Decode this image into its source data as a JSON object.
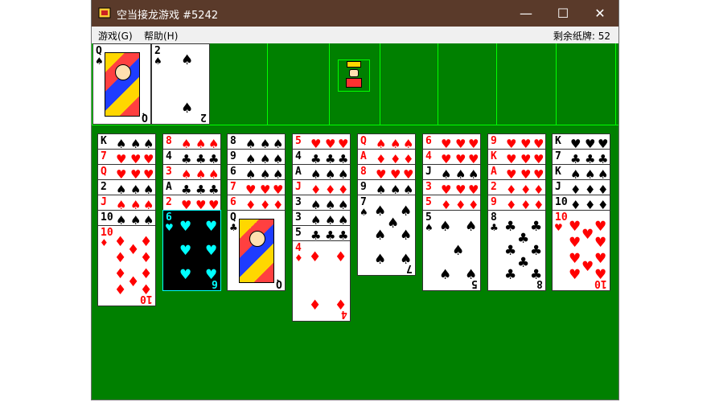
{
  "window": {
    "title": "空当接龙游戏 #5242",
    "minimize_glyph": "—",
    "maximize_glyph": "☐",
    "close_glyph": "✕"
  },
  "menu": {
    "game": "游戏(G)",
    "help": "帮助(H)",
    "status": "剩余纸牌: 52"
  },
  "free_cells": [
    {
      "rank": "Q",
      "suit": "♠",
      "color": "black",
      "face": true
    },
    {
      "rank": "2",
      "suit": "♠",
      "color": "black",
      "face": false
    },
    null,
    null
  ],
  "home_cells": [
    null,
    null,
    null,
    null
  ],
  "center_icon": "king-icon",
  "columns": [
    {
      "cards": [
        {
          "rank": "K",
          "suit": "♠",
          "color": "black"
        },
        {
          "rank": "7",
          "suit": "♥",
          "color": "red"
        },
        {
          "rank": "Q",
          "suit": "♥",
          "color": "red"
        },
        {
          "rank": "2",
          "suit": "♠",
          "color": "black"
        },
        {
          "rank": "J",
          "suit": "♠",
          "color": "red"
        },
        {
          "rank": "10",
          "suit": "♠",
          "color": "black"
        },
        {
          "rank": "10",
          "suit": "♦",
          "color": "red"
        }
      ]
    },
    {
      "cards": [
        {
          "rank": "8",
          "suit": "♠",
          "color": "red"
        },
        {
          "rank": "4",
          "suit": "♣",
          "color": "black"
        },
        {
          "rank": "3",
          "suit": "♠",
          "color": "red"
        },
        {
          "rank": "A",
          "suit": "♣",
          "color": "black"
        },
        {
          "rank": "2",
          "suit": "♥",
          "color": "red"
        },
        {
          "rank": "6",
          "suit": "♥",
          "color": "black",
          "selected": true
        }
      ]
    },
    {
      "cards": [
        {
          "rank": "8",
          "suit": "♠",
          "color": "black"
        },
        {
          "rank": "9",
          "suit": "♠",
          "color": "black"
        },
        {
          "rank": "6",
          "suit": "♠",
          "color": "black"
        },
        {
          "rank": "7",
          "suit": "♥",
          "color": "red"
        },
        {
          "rank": "6",
          "suit": "♦",
          "color": "red"
        },
        {
          "rank": "Q",
          "suit": "♣",
          "color": "black",
          "face": true
        }
      ]
    },
    {
      "cards": [
        {
          "rank": "5",
          "suit": "♥",
          "color": "red"
        },
        {
          "rank": "4",
          "suit": "♣",
          "color": "black"
        },
        {
          "rank": "A",
          "suit": "♠",
          "color": "black"
        },
        {
          "rank": "J",
          "suit": "♦",
          "color": "red"
        },
        {
          "rank": "3",
          "suit": "♠",
          "color": "black"
        },
        {
          "rank": "3",
          "suit": "♠",
          "color": "black"
        },
        {
          "rank": "5",
          "suit": "♣",
          "color": "black"
        },
        {
          "rank": "4",
          "suit": "♦",
          "color": "red"
        }
      ]
    },
    {
      "cards": [
        {
          "rank": "Q",
          "suit": "♠",
          "color": "red"
        },
        {
          "rank": "A",
          "suit": "♦",
          "color": "red"
        },
        {
          "rank": "8",
          "suit": "♥",
          "color": "red"
        },
        {
          "rank": "9",
          "suit": "♠",
          "color": "black"
        },
        {
          "rank": "7",
          "suit": "♠",
          "color": "black"
        }
      ]
    },
    {
      "cards": [
        {
          "rank": "6",
          "suit": "♥",
          "color": "red"
        },
        {
          "rank": "4",
          "suit": "♥",
          "color": "red"
        },
        {
          "rank": "J",
          "suit": "♠",
          "color": "black"
        },
        {
          "rank": "3",
          "suit": "♥",
          "color": "red"
        },
        {
          "rank": "5",
          "suit": "♦",
          "color": "red"
        },
        {
          "rank": "5",
          "suit": "♠",
          "color": "black"
        }
      ]
    },
    {
      "cards": [
        {
          "rank": "9",
          "suit": "♥",
          "color": "red"
        },
        {
          "rank": "K",
          "suit": "♥",
          "color": "red"
        },
        {
          "rank": "A",
          "suit": "♥",
          "color": "red"
        },
        {
          "rank": "2",
          "suit": "♦",
          "color": "red"
        },
        {
          "rank": "9",
          "suit": "♦",
          "color": "red"
        },
        {
          "rank": "8",
          "suit": "♣",
          "color": "black"
        }
      ]
    },
    {
      "cards": [
        {
          "rank": "K",
          "suit": "♥",
          "color": "black"
        },
        {
          "rank": "7",
          "suit": "♣",
          "color": "black"
        },
        {
          "rank": "K",
          "suit": "♠",
          "color": "black"
        },
        {
          "rank": "J",
          "suit": "♦",
          "color": "black"
        },
        {
          "rank": "10",
          "suit": "♦",
          "color": "black"
        },
        {
          "rank": "10",
          "suit": "♥",
          "color": "red"
        }
      ]
    }
  ],
  "colors": {
    "felt": "#008000",
    "cell_border": "#00ff00",
    "titlebar": "#5a3a2a",
    "red_suit": "#ff0000",
    "selected_highlight": "#00ffff"
  }
}
